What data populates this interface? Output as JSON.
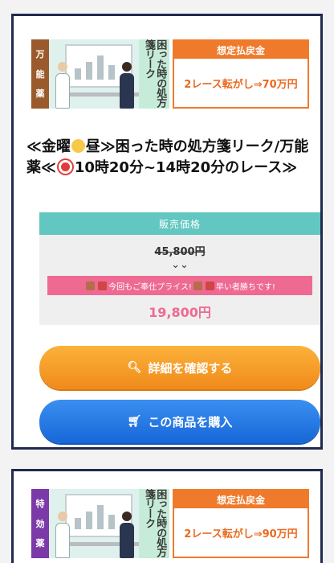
{
  "colors": {
    "card_border": "#1f2a4d",
    "tag_brown": "#9b5a2b",
    "tag_purple": "#7b3aa8",
    "orange": "#ef7a2b",
    "teal": "#62c7c1",
    "pink": "#ee6a93",
    "btn_orange": "#f49a21",
    "btn_blue": "#2a7ce6"
  },
  "cards": [
    {
      "tag": [
        "万",
        "能",
        "薬"
      ],
      "thumb_title": "困った時の処方箋リーク",
      "estimate_label": "想定払戻金",
      "estimate_value": "2レース転がし⇒70万円",
      "title_pre": "≪金曜",
      "title_mid": "昼≫困った時の処方箋リーク/万能薬≪",
      "title_post": "10時20分~14時20分のレース≫",
      "price_label": "販売価格",
      "old_price": "45,800円",
      "arrow": "⌄⌄",
      "promo_a": "今回もご奉仕プライス!",
      "promo_b": "早い者勝ちです!",
      "new_price": "19,800円",
      "detail_btn": "詳細を確認する",
      "buy_btn": "この商品を購入"
    },
    {
      "tag": [
        "特",
        "効",
        "薬"
      ],
      "thumb_title": "困った時の処方箋リーク",
      "estimate_label": "想定払戻金",
      "estimate_value": "2レース転がし⇒90万円"
    }
  ]
}
